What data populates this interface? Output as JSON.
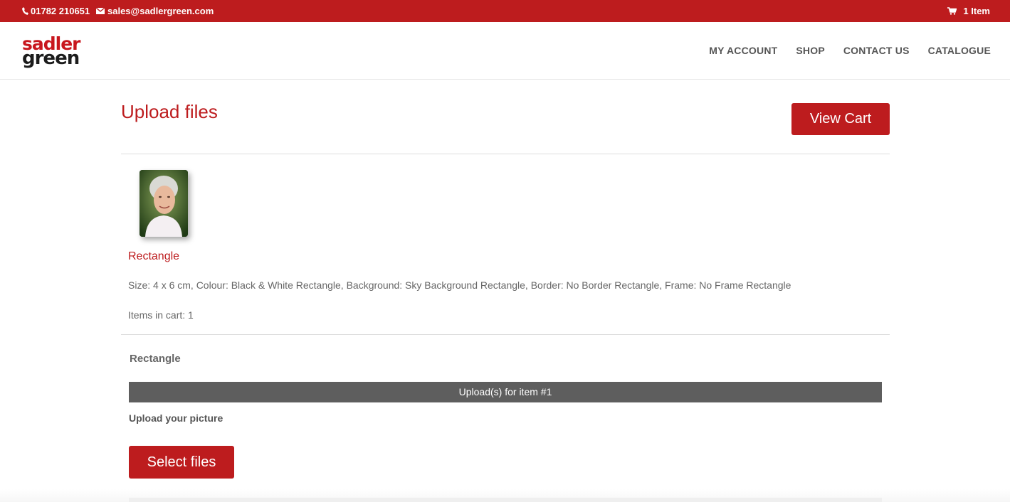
{
  "topbar": {
    "phone": "01782 210651",
    "email": "sales@sadlergreen.com",
    "cart": "1 Item",
    "icons": [
      "phone-icon",
      "envelope-icon",
      "cart-icon"
    ]
  },
  "brand": {
    "line1": "sadler",
    "line2": "green",
    "colors": {
      "accent": "#bd1c1e",
      "dark": "#1c1c1c"
    }
  },
  "nav": {
    "items": [
      {
        "label": "MY ACCOUNT"
      },
      {
        "label": "SHOP"
      },
      {
        "label": "CONTACT US"
      },
      {
        "label": "CATALOGUE"
      }
    ]
  },
  "page": {
    "title": "Upload files",
    "view_cart_label": "View Cart"
  },
  "cart_item": {
    "name": "Rectangle",
    "description": "Size: 4 x 6 cm, Colour: Black & White Rectangle, Background: Sky Background Rectangle, Border: No Border Rectangle, Frame: No Frame Rectangle",
    "items_in_cart": "Items in cart: 1"
  },
  "upload": {
    "product_heading": "Rectangle",
    "bar_label": "Upload(s) for item #1",
    "field_label": "Upload your picture",
    "select_files_label": "Select files"
  }
}
